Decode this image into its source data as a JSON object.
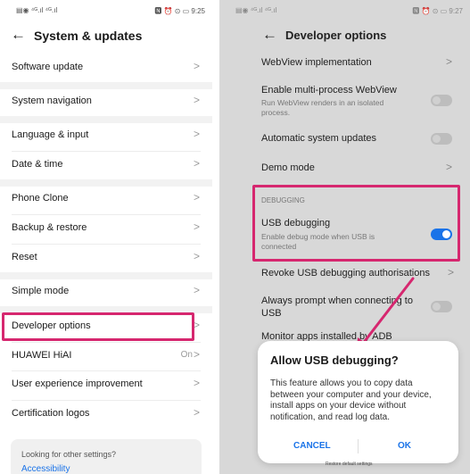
{
  "left": {
    "status_left": "▤◉ ⁴ᴳ.ıl ⁴ᴳ.ıl",
    "status_right": "🅽 ⏰ ⊙ ▭ 9:25",
    "title": "System & updates",
    "items": [
      {
        "label": "Software update"
      },
      {
        "label": "System navigation"
      },
      {
        "label": "Language & input"
      },
      {
        "label": "Date & time"
      },
      {
        "label": "Phone Clone"
      },
      {
        "label": "Backup & restore"
      },
      {
        "label": "Reset"
      },
      {
        "label": "Simple mode"
      },
      {
        "label": "Developer options"
      },
      {
        "label": "HUAWEI HiAI",
        "value": "On"
      },
      {
        "label": "User experience improvement"
      },
      {
        "label": "Certification logos"
      }
    ],
    "footer_question": "Looking for other settings?",
    "footer_link": "Accessibility"
  },
  "right": {
    "status_left": "▤◉ ⁴ᴳ.ıl ⁴ᴳ.ıl",
    "status_right": "🅽 ⏰ ⊙ ▭ 9:27",
    "title": "Developer options",
    "webview_impl": "WebView implementation",
    "multiprocess": "Enable multi-process WebView",
    "multiprocess_sub": "Run WebView renders in an isolated process.",
    "auto_updates": "Automatic system updates",
    "demo_mode": "Demo mode",
    "debugging_header": "DEBUGGING",
    "usb_debugging": "USB debugging",
    "usb_debugging_sub": "Enable debug mode when USB is connected",
    "revoke": "Revoke USB debugging authorisations",
    "always_prompt": "Always prompt when connecting to USB",
    "monitor_apps": "Monitor apps installed by ADB",
    "restore_defaults": "Restore default settings"
  },
  "dialog": {
    "title": "Allow USB debugging?",
    "body": "This feature allows you to copy data between your computer and your device, install apps on your device without notification, and read log data.",
    "cancel": "CANCEL",
    "ok": "OK"
  },
  "colors": {
    "highlight": "#d6276f",
    "accent": "#1a73e8"
  }
}
